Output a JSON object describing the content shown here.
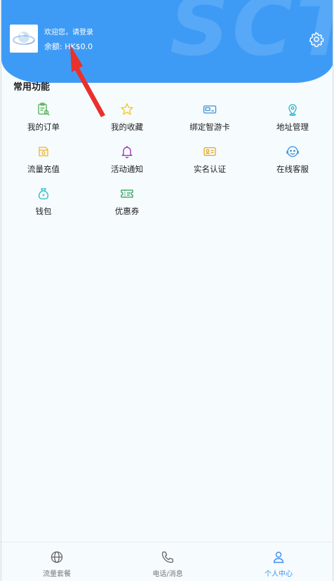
{
  "header": {
    "watermark": "SCT",
    "welcome_text": "欢迎您，请登录",
    "balance_text": "余额: HK$0.0",
    "accent_color": "#3e9bf5"
  },
  "section": {
    "title": "常用功能"
  },
  "features": [
    {
      "label": "我的订单",
      "icon": "order-list-icon",
      "color": "#4caf50"
    },
    {
      "label": "我的收藏",
      "icon": "star-icon",
      "color": "#f5c518"
    },
    {
      "label": "绑定智游卡",
      "icon": "card-icon",
      "color": "#3b8fd8"
    },
    {
      "label": "地址管理",
      "icon": "location-icon",
      "color": "#2bb5c9"
    },
    {
      "label": "流量充值",
      "icon": "data-topup-icon",
      "color": "#f0b429"
    },
    {
      "label": "活动通知",
      "icon": "bell-icon",
      "color": "#9c27b0"
    },
    {
      "label": "实名认证",
      "icon": "id-card-icon",
      "color": "#e6a817"
    },
    {
      "label": "在线客服",
      "icon": "customer-service-icon",
      "color": "#3b8fd8"
    },
    {
      "label": "钱包",
      "icon": "wallet-icon",
      "color": "#2bb5c9"
    },
    {
      "label": "优惠券",
      "icon": "coupon-icon",
      "color": "#2e9e5a"
    }
  ],
  "tabbar": [
    {
      "label": "流量套餐",
      "icon": "globe-icon",
      "active": false
    },
    {
      "label": "电话/消息",
      "icon": "phone-icon",
      "active": false
    },
    {
      "label": "个人中心",
      "icon": "person-icon",
      "active": true
    }
  ],
  "annotation": {
    "arrow_color": "#e8312c"
  }
}
